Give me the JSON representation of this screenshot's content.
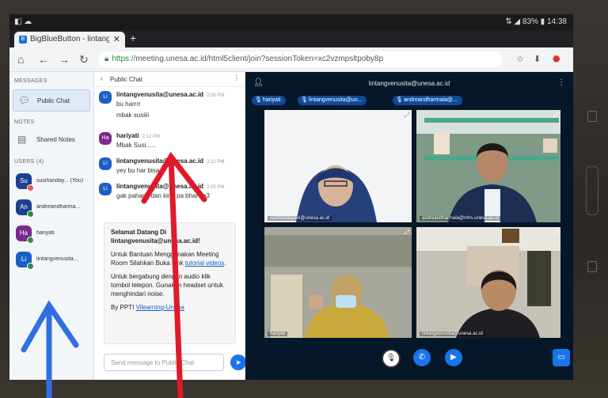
{
  "statusbar": {
    "left": "◧ ☁",
    "right": "⇅ ◢ 83% ▮ 14:38"
  },
  "browser": {
    "tab_title": "BigBlueButton - lintangvenus",
    "url_scheme": "https://",
    "url_rest": "meeting.unesa.ac.id/html5client/join?sessionToken=xc2vzmpsltpoby8p"
  },
  "sidebar": {
    "messages_header": "MESSAGES",
    "public_chat_label": "Public Chat",
    "notes_header": "NOTES",
    "shared_notes_label": "Shared Notes",
    "users_header": "USERS (4)",
    "users": [
      {
        "initials": "Su",
        "name": "susihanday... (You)",
        "color": "#1f3f8f"
      },
      {
        "initials": "An",
        "name": "andreandharma...",
        "color": "#1f3f8f"
      },
      {
        "initials": "Ha",
        "name": "hariyati",
        "color": "#7a2a8a"
      },
      {
        "initials": "Li",
        "name": "lintangvenusita...",
        "color": "#1c5fc4"
      }
    ]
  },
  "chat": {
    "header": "Public Chat",
    "messages": [
      {
        "initials": "Li",
        "name": "lintangvenusita@unesa.ac.id",
        "time": "2:09 PM",
        "lines": [
          "bu harrrr",
          "mbak susiiii"
        ],
        "color": "#1c5fc4"
      },
      {
        "initials": "Ha",
        "name": "hariyati",
        "time": "2:12 PM",
        "lines": [
          "Mbak Susi......"
        ],
        "color": "#7a2a8a"
      },
      {
        "initials": "Li",
        "name": "lintangvenusita@unesa.ac.id",
        "time": "2:12 PM",
        "lines": [
          "yey bu har bisa"
        ],
        "color": "#1c5fc4"
      },
      {
        "initials": "Li",
        "name": "lintangvenusita@unesa.ac.id",
        "time": "2:25 PM",
        "lines": [
          "gak pahami dan kirip pa bhai ha3"
        ],
        "color": "#1c5fc4"
      }
    ],
    "welcome": {
      "l1": "Selamat Datang Di",
      "l2": "lintangvenusita@unesa.ac.id!",
      "l3": "Untuk Bantuan Menggunakan Meeting",
      "l4a": "Room Silahkan Buka Link ",
      "l4b": "tutorial videos",
      "l4c": ".",
      "l5": "Untuk bergabung dengan audio klik",
      "l6": "tombol telepon. Gunakan headset untuk",
      "l7": "menghindari noise.",
      "l8a": "By PPTI ",
      "l8b": "Vilearning-Unesa"
    },
    "input_placeholder": "Send message to Public Chat"
  },
  "video": {
    "presenter": "lintangvenusita@unesa.ac.id",
    "talking": [
      "hariyati",
      "lintangvenusita@un...",
      "andreandharmala@..."
    ],
    "tiles": [
      {
        "name": "susihandayani@unesa.ac.id"
      },
      {
        "name": "andreandharmala@mhs.unesa.ac.id"
      },
      {
        "name": "hariyati"
      },
      {
        "name": "lintangvenusita@unesa.ac.id"
      }
    ]
  },
  "colors": {
    "accent": "#1a73e8",
    "annotation_blue": "#2f6fe0",
    "annotation_red": "#e0192b"
  }
}
